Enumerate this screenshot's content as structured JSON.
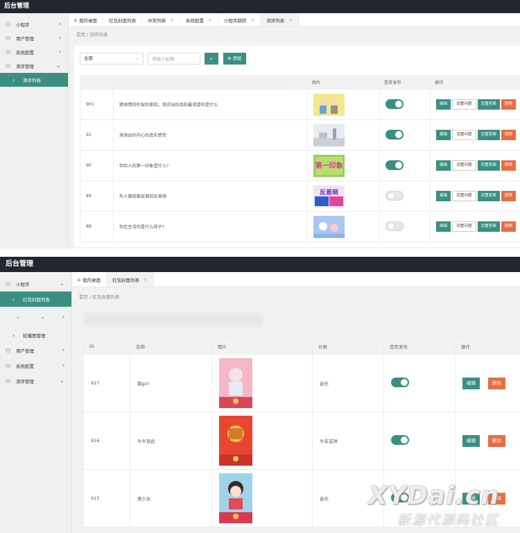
{
  "panel1": {
    "app_title": "后台管理",
    "sidebar": [
      {
        "label": "小程序",
        "icon": "user-icon",
        "chevron": "‹"
      },
      {
        "label": "用户管理",
        "icon": "user-icon",
        "chevron": "‹"
      },
      {
        "label": "系统配置",
        "icon": "user-icon",
        "chevron": "‹"
      },
      {
        "label": "测评管理",
        "icon": "user-icon",
        "chevron": "⌄"
      },
      {
        "label": "测评列表",
        "icon": "arrow-icon",
        "active": true
      }
    ],
    "tabs": [
      {
        "label": "我的桌面",
        "icon": "home-icon"
      },
      {
        "label": "红包封面列表",
        "close": "×"
      },
      {
        "label": "中奖列表",
        "close": "×"
      },
      {
        "label": "系统配置",
        "close": "×"
      },
      {
        "label": "小程序跳转",
        "close": "×"
      },
      {
        "label": "测评列表",
        "close": "×",
        "active": true
      }
    ],
    "breadcrumb": "首页 / 测评列表",
    "filter": {
      "select_value": "全部",
      "search_placeholder": "请输入标题",
      "search_icon": "search-icon",
      "add_label": "⊕ 添加"
    },
    "table": {
      "headers": [
        "",
        "",
        "图片",
        "是否发布",
        "操作"
      ],
      "rows": [
        {
          "id": "901",
          "title": "猜测情侣吵架的原因，测试出你目前最渴望的是什么",
          "published": true
        },
        {
          "id": "91",
          "title": "测测出你内心的真实感受",
          "published": true
        },
        {
          "id": "90",
          "title": "你给人的第一印象是什么?",
          "published": true
        },
        {
          "id": "89",
          "title": "外人面前跟友面前反差萌",
          "published": false
        },
        {
          "id": "88",
          "title": "你在生活中是什么样子?",
          "published": false
        }
      ],
      "image_texts": {
        "row3": "第一印象",
        "row4": "反差萌"
      },
      "actions": {
        "edit": "编辑",
        "set_question": "设置问题",
        "set_answer": "设置答案",
        "delete": "删除"
      }
    }
  },
  "panel2": {
    "app_title": "后台管理",
    "sidebar": [
      {
        "label": "小程序",
        "icon": "user-icon",
        "chevron": "⌄"
      },
      {
        "label": "红包封面列表",
        "icon": "arrow-icon",
        "active": true
      },
      {
        "label": "",
        "icon": "chevron-left-icon",
        "chevron": "‹"
      },
      {
        "label": "轮播图管理",
        "icon": "arrow-icon"
      },
      {
        "label": "用户管理",
        "icon": "user-icon",
        "chevron": "‹"
      },
      {
        "label": "系统配置",
        "icon": "user-icon",
        "chevron": "‹"
      },
      {
        "label": "测评管理",
        "icon": "user-icon",
        "chevron": "⌄"
      }
    ],
    "tabs": [
      {
        "label": "我的桌面",
        "icon": "home-icon"
      },
      {
        "label": "红包封面列表",
        "close": "×",
        "active": true
      }
    ],
    "breadcrumb": "首页 / 红包封面列表",
    "table": {
      "headers": [
        "ID",
        "名称",
        "图片",
        "分类",
        "是否发布",
        "操作"
      ],
      "rows": [
        {
          "id": "917",
          "name": "鹅girl",
          "category": "音乐",
          "published": true
        },
        {
          "id": "916",
          "name": "牛牛到此",
          "category": "牛年吉祥",
          "published": true
        },
        {
          "id": "915",
          "name": "美少女",
          "category": "音乐",
          "published": true
        }
      ],
      "actions": {
        "edit": "编辑",
        "delete": "删除"
      }
    }
  },
  "watermark": {
    "brand": "XYDai.cn",
    "subtitle": "新源代源码社区"
  },
  "colors": {
    "topbar": "#23262e",
    "accent": "#3a8f82",
    "danger": "#e86d43"
  }
}
